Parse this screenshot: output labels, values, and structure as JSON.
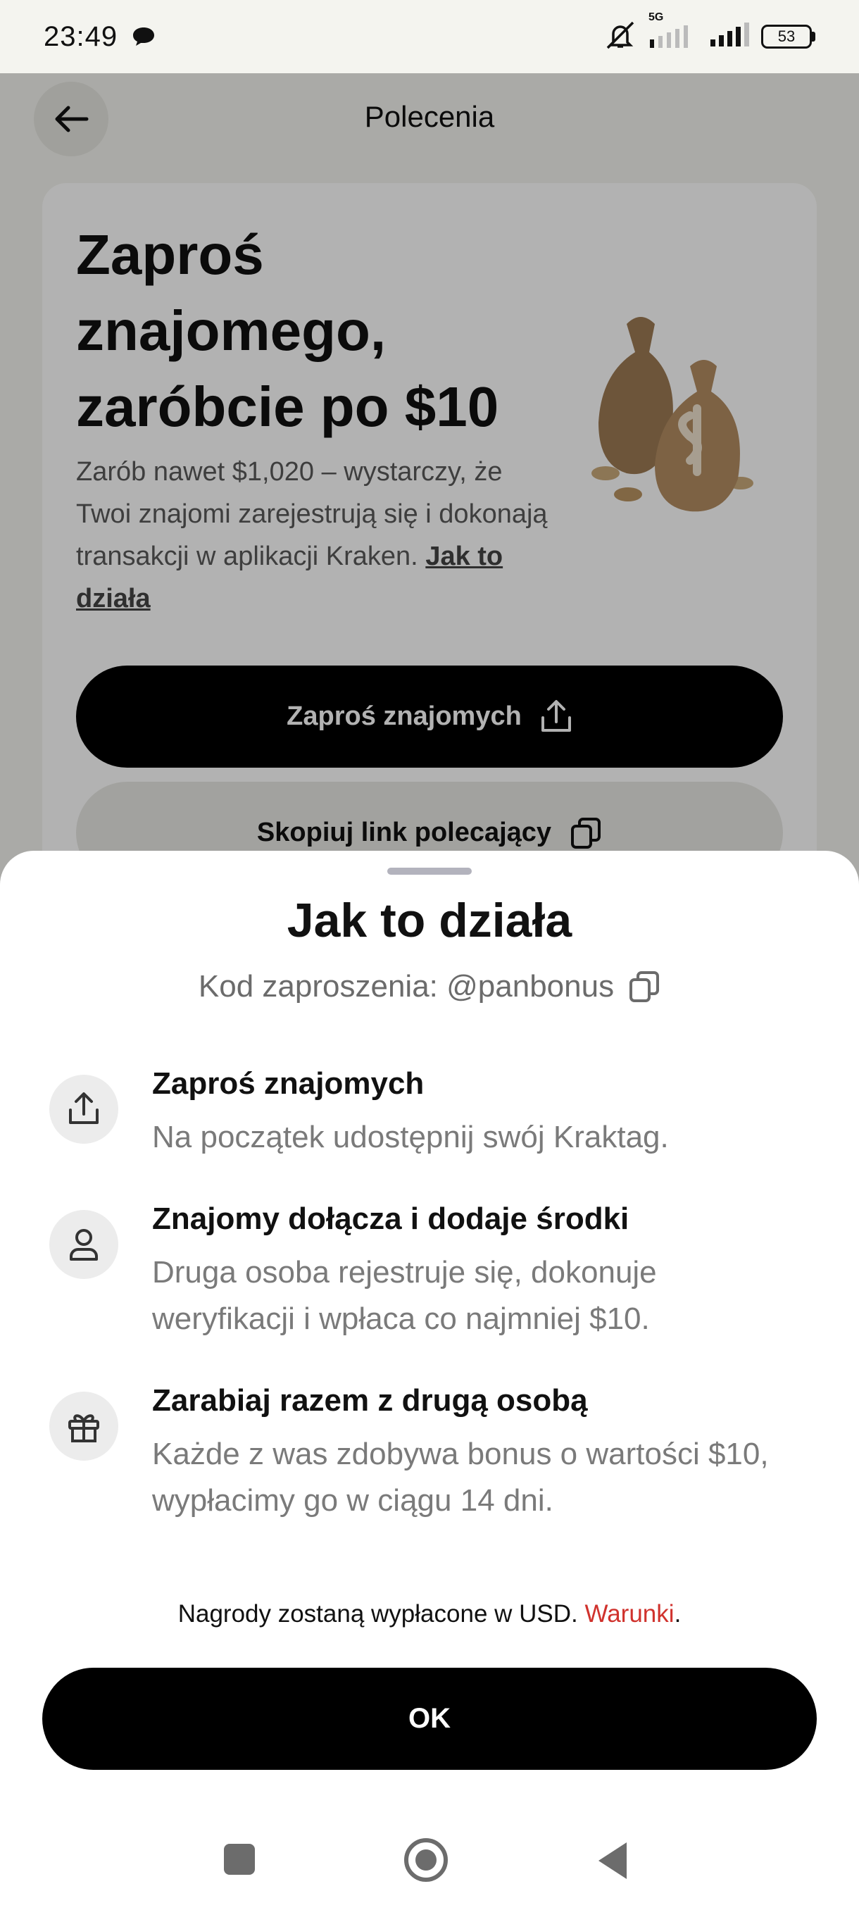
{
  "status_bar": {
    "time": "23:49",
    "network_label": "5G",
    "battery_level": "53",
    "icons": [
      "chat-icon",
      "mute-icon",
      "signal-5g-icon",
      "signal-icon",
      "battery-icon"
    ]
  },
  "header": {
    "title": "Polecenia",
    "back_icon": "arrow-left-icon"
  },
  "promo": {
    "heading": "Zaproś znajomego, zaróbcie po $10",
    "description": "Zarób nawet $1,020 – wystarczy, że Twoi znajomi zarejestrują się i dokonają transakcji w aplikacji Kraken. ",
    "link_label": "Jak to działa",
    "invite_button_label": "Zaproś znajomych",
    "copy_button_label": "Skopiuj link polecający"
  },
  "sheet": {
    "title": "Jak to działa",
    "invite_code": "Kod zaproszenia: @panbonus",
    "steps": [
      {
        "icon": "share-icon",
        "title": "Zaproś znajomych",
        "description": "Na początek udostępnij swój Kraktag."
      },
      {
        "icon": "person-icon",
        "title": "Znajomy dołącza i dodaje środki",
        "description": "Druga osoba rejestruje się, dokonuje weryfikacji i wpłaca co najmniej $10."
      },
      {
        "icon": "gift-icon",
        "title": "Zarabiaj razem z drugą osobą",
        "description": "Każde z was zdobywa bonus o wartości $10, wypłacimy go w ciągu 14 dni."
      }
    ],
    "rewards_note": "Nagrody zostaną wypłacone w USD. ",
    "terms_link": "Warunki",
    "terms_suffix": ".",
    "ok_button_label": "OK"
  },
  "colors": {
    "accent_link": "#d0322d",
    "primary_button": "#000000",
    "page_background": "#f4f4ef"
  }
}
